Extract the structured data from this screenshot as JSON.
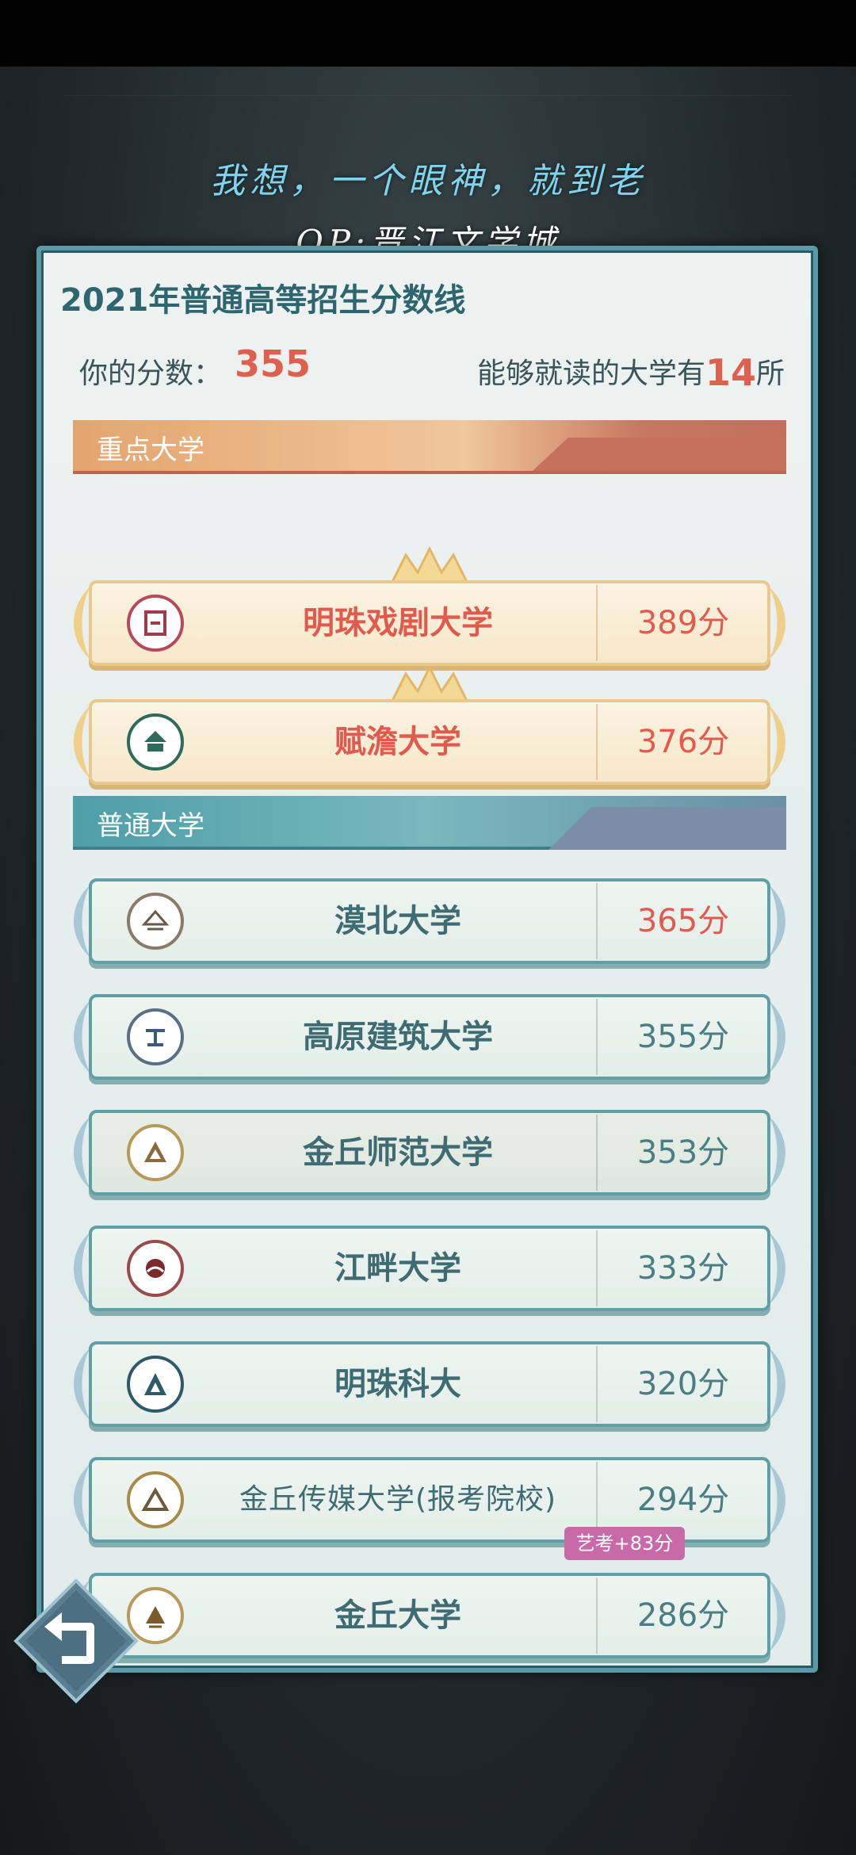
{
  "quote": {
    "line1": "我想，一个眼神，就到老",
    "line2": "OP:晋江文学城"
  },
  "panel": {
    "title": "2021年普通高等招生分数线",
    "score_label": "你的分数：",
    "score_value": "355",
    "unis_prefix": "能够就读的大学有",
    "unis_count": "14",
    "unis_suffix": "所"
  },
  "sections": {
    "key": "重点大学",
    "normal": "普通大学"
  },
  "key_universities": [
    {
      "name": "明珠戏剧大学",
      "score": "389分"
    },
    {
      "name": "赋澹大学",
      "score": "376分"
    }
  ],
  "normal_universities": [
    {
      "name": "漠北大学",
      "score": "365分",
      "highlight": true
    },
    {
      "name": "高原建筑大学",
      "score": "355分",
      "highlight": false
    },
    {
      "name": "金丘师范大学",
      "score": "353分",
      "highlight": false
    },
    {
      "name": "江畔大学",
      "score": "333分",
      "highlight": false
    },
    {
      "name": "明珠科大",
      "score": "320分",
      "highlight": false
    },
    {
      "name": "金丘传媒大学(报考院校)",
      "score": "294分",
      "highlight": false
    },
    {
      "name": "金丘大学",
      "score": "286分",
      "highlight": false
    }
  ],
  "art_badge": "艺考+83分",
  "colors": {
    "accent_red": "#e35a4f",
    "teal": "#3f6c72",
    "gold_border": "#e9c98c"
  },
  "icons": {
    "back": "back-arrow-icon",
    "logo": "university-seal-icon",
    "wing": "laurel-wing-icon",
    "crown": "crown-icon"
  }
}
